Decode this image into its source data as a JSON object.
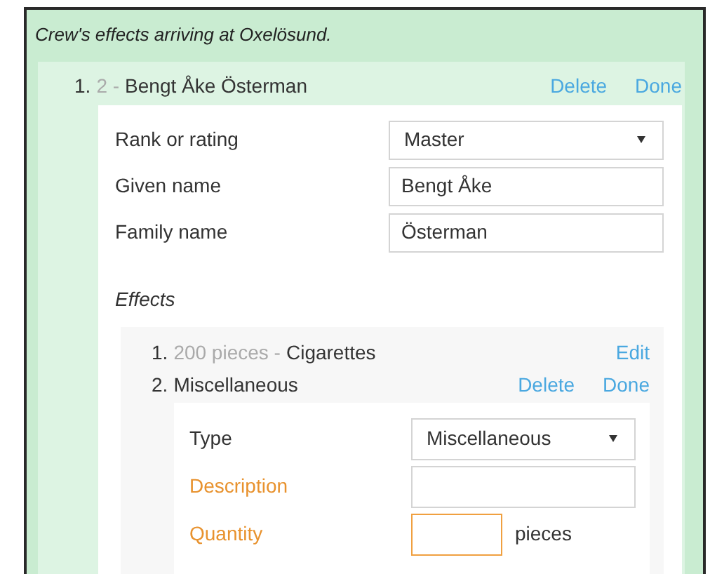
{
  "notice": "Crew's effects arriving at Oxelösund.",
  "crew": [
    {
      "number": "1.",
      "rank_code": "2 -",
      "name": "Bengt Åke Österman",
      "actions": [
        "Delete",
        "Done"
      ],
      "expanded": true,
      "fields": [
        {
          "kind": "select",
          "label": "Rank or rating",
          "value": "Master",
          "invalid": false,
          "focused": false
        },
        {
          "kind": "text",
          "label": "Given name",
          "value": "Bengt Åke",
          "invalid": false,
          "focused": false
        },
        {
          "kind": "text",
          "label": "Family name",
          "value": "Österman",
          "invalid": false,
          "focused": false
        }
      ],
      "effects_heading": "Effects",
      "effects": [
        {
          "number": "1.",
          "quantity": "200 pieces -",
          "name": "Cigarettes",
          "actions": [
            "Edit"
          ]
        },
        {
          "number": "2.",
          "name": "Miscellaneous",
          "actions": [
            "Delete",
            "Done"
          ],
          "fields": [
            {
              "kind": "select",
              "label": "Type",
              "value": "Miscellaneous",
              "invalid": false,
              "focused": false
            },
            {
              "kind": "text",
              "label": "Description",
              "invalid": true,
              "focused": false
            },
            {
              "kind": "quantity",
              "label": "Quantity",
              "unit": "pieces",
              "invalid": true,
              "focused": true
            }
          ]
        }
      ]
    }
  ]
}
